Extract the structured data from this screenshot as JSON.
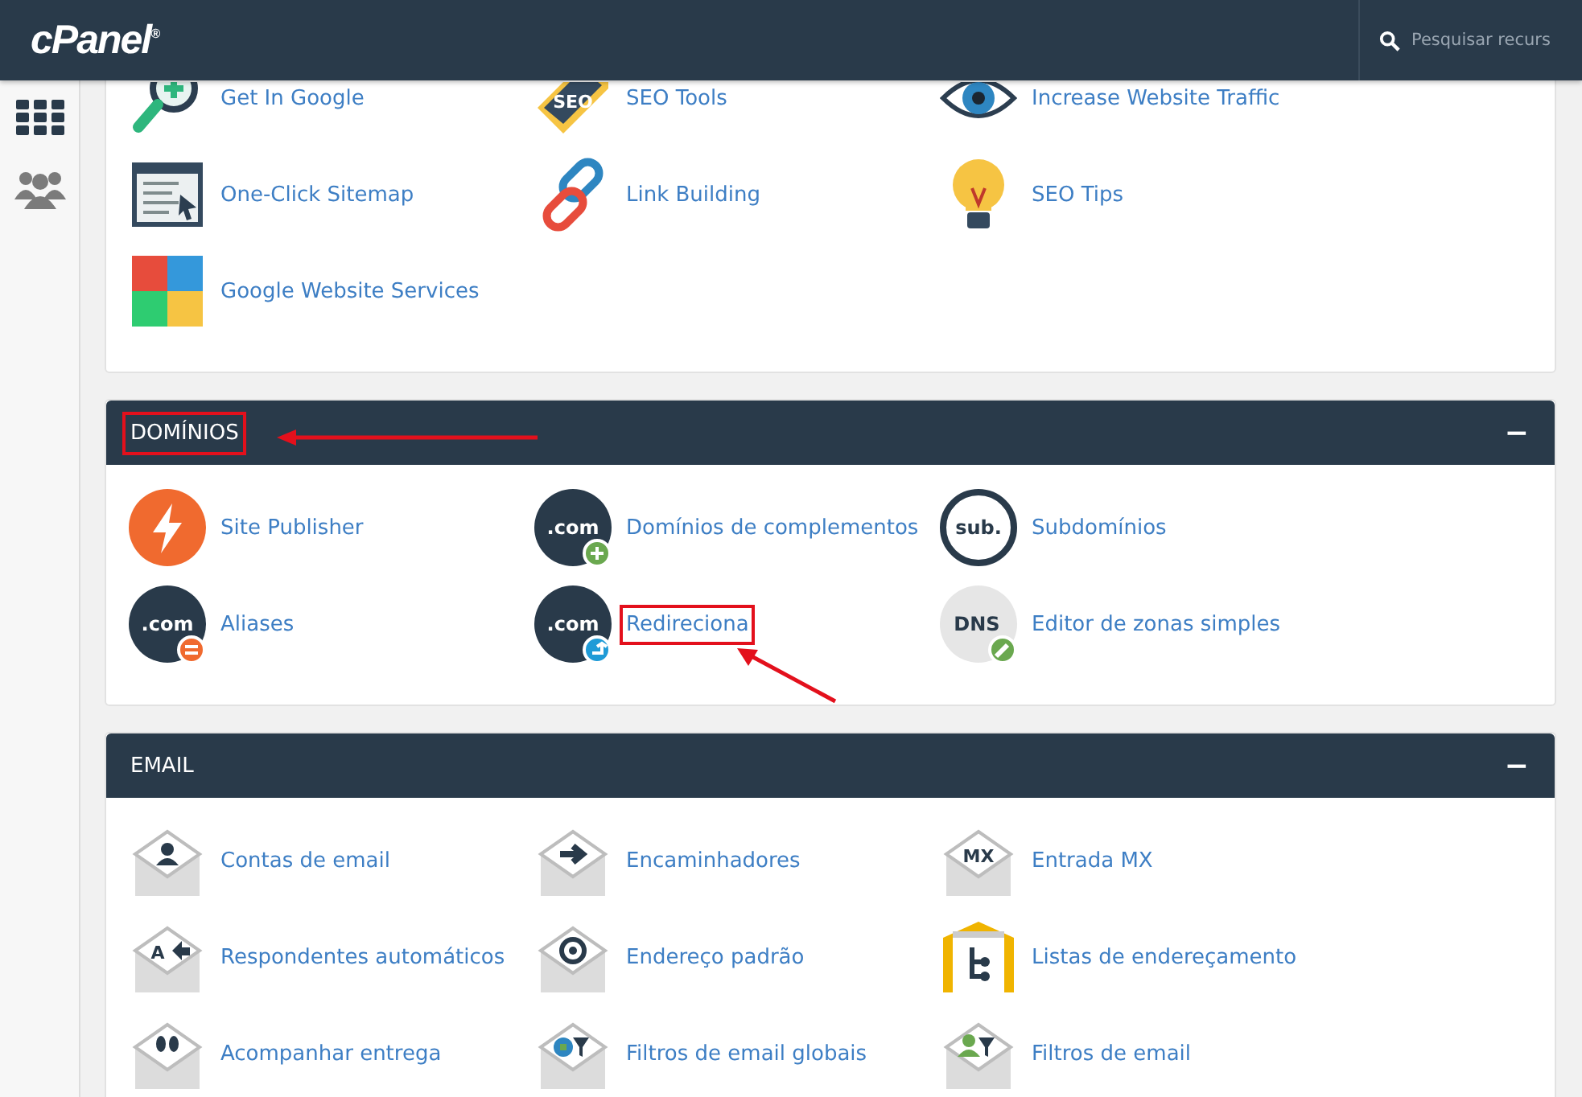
{
  "topbar": {
    "logo": "cPanel$^{®}$",
    "search": {
      "placeholder": "Pesquisar recurs"
    }
  },
  "sections": [
    {
      "items": [
        {
          "label": "Get In Google",
          "highlighted": false
        },
        {
          "label": "SEO Tools",
          "icon_text": "SEO",
          "highlighted": false
        },
        {
          "label": "Increase Website Traffic",
          "highlighted": false
        },
        {
          "label": "One-Click Sitemap",
          "highlighted": false
        },
        {
          "label": "Link Building",
          "highlighted": false
        },
        {
          "label": "SEO Tips",
          "highlighted": false
        },
        {
          "label": "Google Website Services",
          "highlighted": false
        }
      ]
    },
    {
      "title": "DOMÍNIOS",
      "highlighted": true,
      "collapse": "−",
      "items": [
        {
          "label": "Site Publisher",
          "highlighted": false
        },
        {
          "label": "Domínios de complementos",
          "icon_text": ".com",
          "highlighted": false
        },
        {
          "label": "Subdomínios",
          "icon_text": "sub.",
          "highlighted": false
        },
        {
          "label": "Aliases",
          "icon_text": ".com",
          "highlighted": false
        },
        {
          "label": "Redireciona",
          "icon_text": ".com",
          "highlighted": true
        },
        {
          "label": "Editor de zonas simples",
          "icon_text": "DNS",
          "highlighted": false
        }
      ]
    },
    {
      "title": "EMAIL",
      "highlighted": false,
      "collapse": "−",
      "items": [
        {
          "label": "Contas de email",
          "highlighted": false
        },
        {
          "label": "Encaminhadores",
          "highlighted": false
        },
        {
          "label": "Entrada MX",
          "icon_text": "MX",
          "highlighted": false
        },
        {
          "label": "Respondentes automáticos",
          "icon_text": "A",
          "highlighted": false
        },
        {
          "label": "Endereço padrão",
          "highlighted": false
        },
        {
          "label": "Listas de endereçamento",
          "highlighted": false
        },
        {
          "label": "Acompanhar entrega",
          "highlighted": false
        },
        {
          "label": "Filtros de email globais",
          "highlighted": false
        },
        {
          "label": "Filtros de email",
          "highlighted": false
        }
      ]
    }
  ]
}
